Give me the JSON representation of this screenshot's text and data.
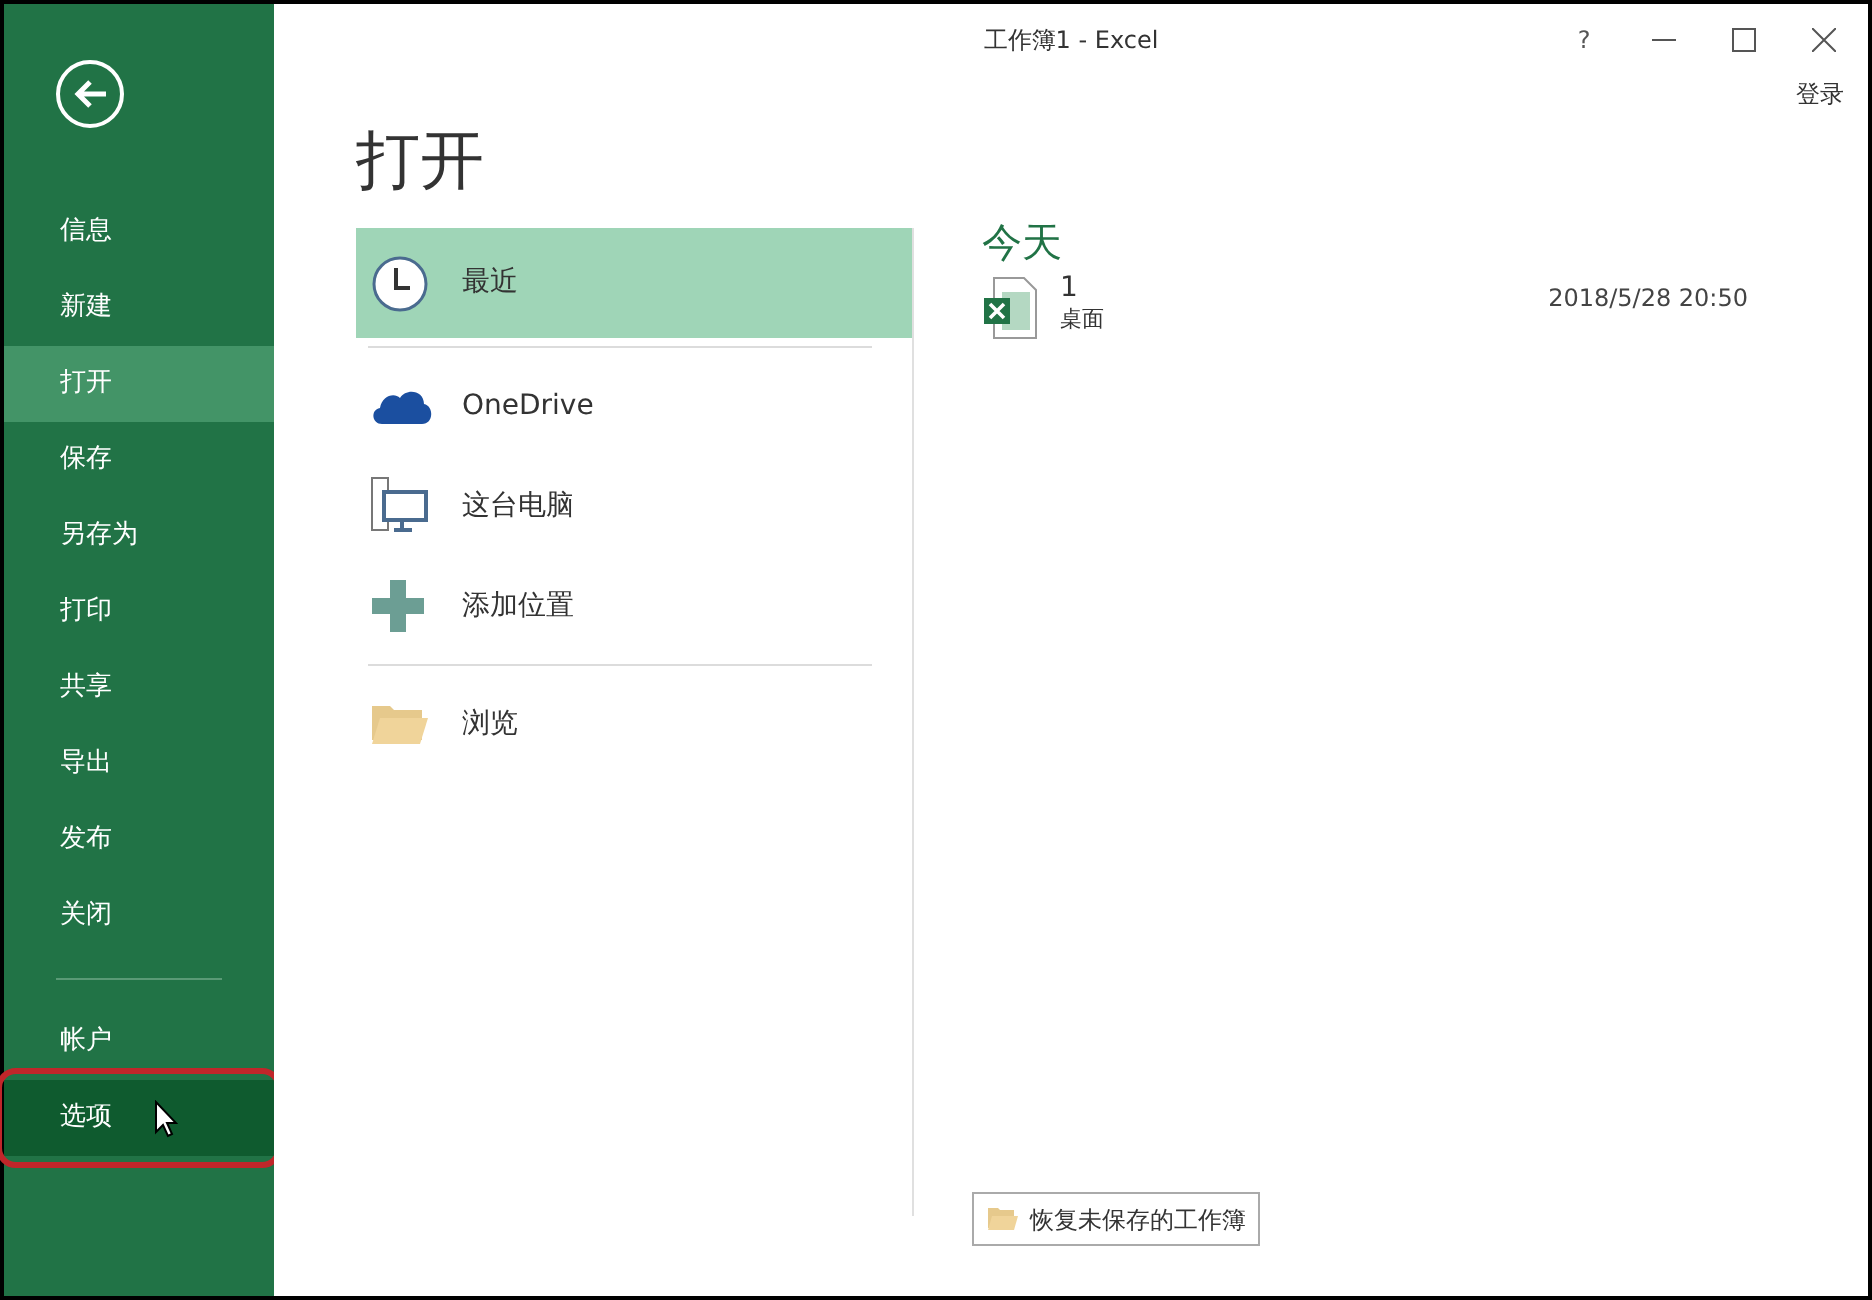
{
  "window": {
    "title": "工作簿1 - Excel",
    "help": "?",
    "sign_in": "登录"
  },
  "sidebar": {
    "items": [
      {
        "label": "信息",
        "selected": false,
        "hovered": false,
        "highlighted": false
      },
      {
        "label": "新建",
        "selected": false,
        "hovered": false,
        "highlighted": false
      },
      {
        "label": "打开",
        "selected": true,
        "hovered": false,
        "highlighted": false
      },
      {
        "label": "保存",
        "selected": false,
        "hovered": false,
        "highlighted": false
      },
      {
        "label": "另存为",
        "selected": false,
        "hovered": false,
        "highlighted": false
      },
      {
        "label": "打印",
        "selected": false,
        "hovered": false,
        "highlighted": false
      },
      {
        "label": "共享",
        "selected": false,
        "hovered": false,
        "highlighted": false
      },
      {
        "label": "导出",
        "selected": false,
        "hovered": false,
        "highlighted": false
      },
      {
        "label": "发布",
        "selected": false,
        "hovered": false,
        "highlighted": false
      },
      {
        "label": "关闭",
        "selected": false,
        "hovered": false,
        "highlighted": false
      }
    ],
    "bottom_items": [
      {
        "label": "帐户",
        "selected": false,
        "hovered": false,
        "highlighted": false
      },
      {
        "label": "选项",
        "selected": false,
        "hovered": true,
        "highlighted": true
      }
    ]
  },
  "page_title": "打开",
  "places": [
    [
      {
        "label": "最近",
        "selected": true
      }
    ],
    [
      {
        "label": "OneDrive",
        "selected": false
      },
      {
        "label": "这台电脑",
        "selected": false
      },
      {
        "label": "添加位置",
        "selected": false
      }
    ],
    [
      {
        "label": "浏览",
        "selected": false
      }
    ]
  ],
  "recent": {
    "heading": "今天",
    "files": [
      {
        "name": "1",
        "location": "桌面",
        "date": "2018/5/28 20:50"
      }
    ]
  },
  "recover_button": "恢复未保存的工作簿"
}
